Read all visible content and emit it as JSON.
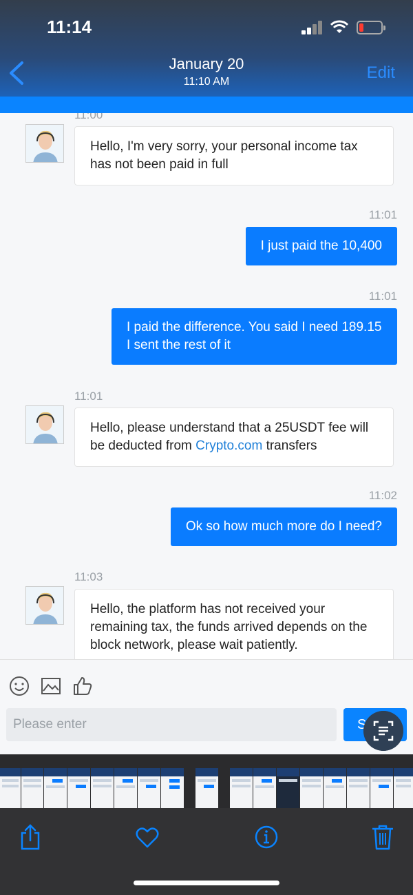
{
  "status_bar": {
    "time": "11:14"
  },
  "viewer_header": {
    "date": "January 20",
    "time": "11:10 AM",
    "edit_label": "Edit"
  },
  "messages": [
    {
      "timestamp": "11:00",
      "text": "Hello, I'm very sorry, your personal income tax has not been paid in full"
    },
    {
      "timestamp": "11:01",
      "text": "I just paid the 10,400"
    },
    {
      "timestamp": "11:01",
      "text": "I paid the difference. You said I need 189.15 I sent the rest of it"
    },
    {
      "timestamp": "11:01",
      "text_before": "Hello, please understand that a 25USDT fee will be deducted from ",
      "link": "Crypto.com",
      "text_after": " transfers"
    },
    {
      "timestamp": "11:02",
      "text": "Ok so how much more do I need?"
    },
    {
      "timestamp": "11:03",
      "text": "Hello, the platform has not received your remaining tax, the funds arrived depends on the block network, please wait patiently."
    }
  ],
  "composer": {
    "placeholder": "Please enter",
    "send_label": "Send"
  },
  "icons": {
    "emoji": "emoji-icon",
    "image": "image-icon",
    "like": "thumbs-up-icon",
    "scan": "scan-text-icon",
    "share": "share-icon",
    "favorite": "heart-icon",
    "info": "info-icon",
    "delete": "trash-icon",
    "back": "chevron-left-icon"
  },
  "colors": {
    "accent": "#0a84ff",
    "header_gradient_top": "#333e4c",
    "toolbar": "#323234"
  }
}
